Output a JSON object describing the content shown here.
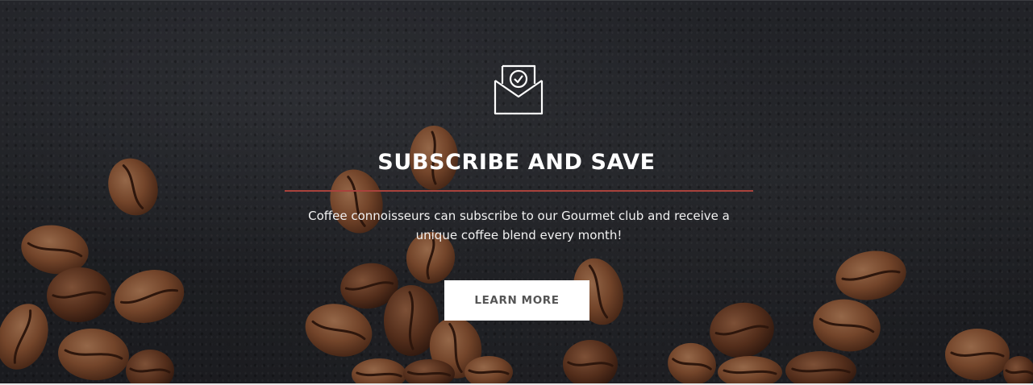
{
  "banner": {
    "icon": "envelope-check-icon",
    "title": "SUBSCRIBE AND SAVE",
    "description": "Coffee connoisseurs can subscribe to our Gourmet club and receive a unique coffee blend every month!",
    "button_label": "LEARN MORE"
  },
  "colors": {
    "divider": "#a8423c",
    "background": "#25272b",
    "button_bg": "#ffffff",
    "button_text": "#555555",
    "title_text": "#ffffff"
  }
}
